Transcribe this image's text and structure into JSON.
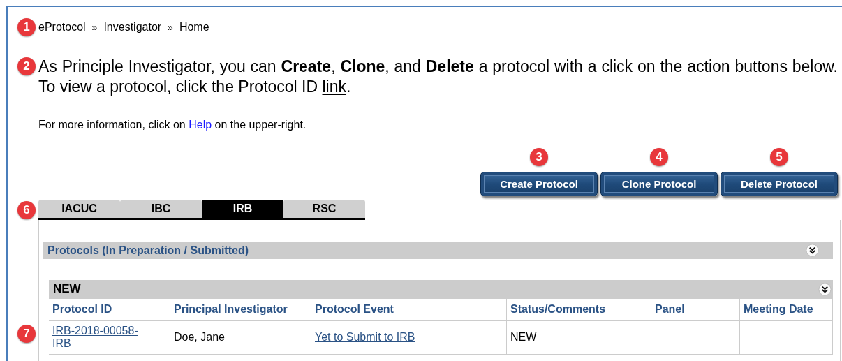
{
  "breadcrumb": {
    "callout": "1",
    "separator": "»",
    "items": [
      "eProtocol",
      "Investigator",
      "Home"
    ]
  },
  "intro": {
    "callout": "2",
    "text": "As Principle Investigator, you can **Create**, **Clone**, and **Delete** a protocol with a click on the action buttons below. To view a protocol, click the Protocol ID ",
    "link": "link",
    "after": "."
  },
  "help_note": {
    "before": "For more information, click on ",
    "link": "Help",
    "after": " on the upper-right."
  },
  "actions": [
    {
      "label": "Create Protocol",
      "callout": "3"
    },
    {
      "label": "Clone Protocol",
      "callout": "4"
    },
    {
      "label": "Delete Protocol",
      "callout": "5"
    }
  ],
  "tabs": {
    "callout": "6",
    "items": [
      {
        "label": "IACUC",
        "selected": false
      },
      {
        "label": "IBC",
        "selected": false
      },
      {
        "label": "IRB",
        "selected": true
      },
      {
        "label": "RSC",
        "selected": false
      }
    ]
  },
  "panel": {
    "title": "Protocols (In Preparation / Submitted)",
    "section": {
      "title": "NEW",
      "callout": "7",
      "columns": [
        "Protocol ID",
        "Principal Investigator",
        "Protocol Event",
        "Status/Comments",
        "Panel",
        "Meeting Date"
      ],
      "rows": [
        [
          {
            "kind": "link",
            "text": "IRB-2018-00058-IRB"
          },
          {
            "kind": "text",
            "text": "Doe, Jane"
          },
          {
            "kind": "link",
            "text": "Yet to Submit to IRB"
          },
          {
            "kind": "text",
            "text": "NEW"
          },
          {
            "kind": "empty"
          },
          {
            "kind": "empty"
          }
        ]
      ]
    }
  }
}
